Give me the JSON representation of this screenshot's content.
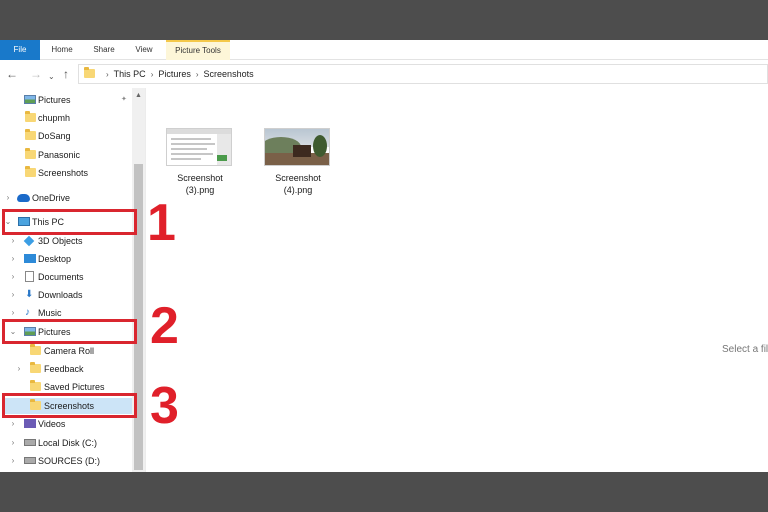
{
  "ribbon": {
    "file": "File",
    "home": "Home",
    "share": "Share",
    "view": "View",
    "picture_tools": "Picture Tools"
  },
  "address": {
    "crumbs": [
      "This PC",
      "Pictures",
      "Screenshots"
    ]
  },
  "nav": {
    "quick_access": [
      "Pictures",
      "chupmh",
      "DoSang",
      "Panasonic",
      "Screenshots"
    ],
    "onedrive": "OneDrive",
    "this_pc": "This PC",
    "pc_children": [
      "3D Objects",
      "Desktop",
      "Documents",
      "Downloads",
      "Music"
    ],
    "pictures": "Pictures",
    "pictures_children": [
      "Camera Roll",
      "Feedback",
      "Saved Pictures",
      "Screenshots"
    ],
    "after": [
      "Videos",
      "Local Disk (C:)",
      "SOURCES (D:)"
    ]
  },
  "annotations": [
    "1",
    "2",
    "3"
  ],
  "files": [
    {
      "name_line1": "Screenshot",
      "name_line2": "(3).png"
    },
    {
      "name_line1": "Screenshot",
      "name_line2": "(4).png"
    }
  ],
  "preview_hint": "Select a file",
  "colors": {
    "accent": "#1979ca",
    "highlight": "#e0202a",
    "selection": "#cce4f7"
  }
}
